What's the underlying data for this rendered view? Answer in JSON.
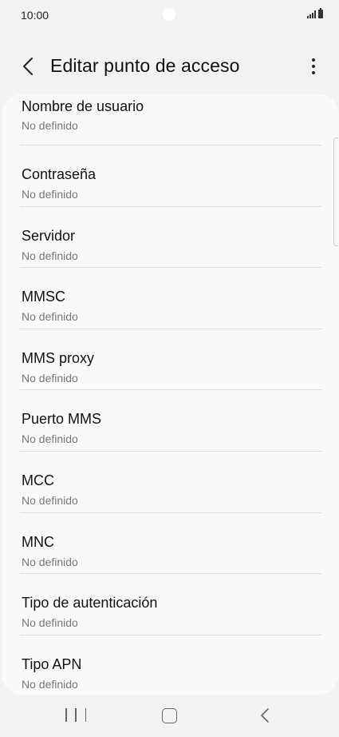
{
  "status_bar": {
    "time": "10:00"
  },
  "header": {
    "title": "Editar punto de acceso",
    "back_icon": "chevron-left-icon",
    "menu_icon": "more-vertical-icon"
  },
  "settings": [
    {
      "label": "Nombre de usuario",
      "value": "No definido"
    },
    {
      "label": "Contraseña",
      "value": "No definido"
    },
    {
      "label": "Servidor",
      "value": "No definido"
    },
    {
      "label": "MMSC",
      "value": "No definido"
    },
    {
      "label": "MMS proxy",
      "value": "No definido"
    },
    {
      "label": "Puerto MMS",
      "value": "No definido"
    },
    {
      "label": "MCC",
      "value": "No definido"
    },
    {
      "label": "MNC",
      "value": "No definido"
    },
    {
      "label": "Tipo de autenticación",
      "value": "No definido"
    },
    {
      "label": "Tipo APN",
      "value": "No definido"
    }
  ],
  "nav_bar": {
    "recents_icon": "recents-icon",
    "home_icon": "home-icon",
    "back_icon": "back-icon"
  }
}
